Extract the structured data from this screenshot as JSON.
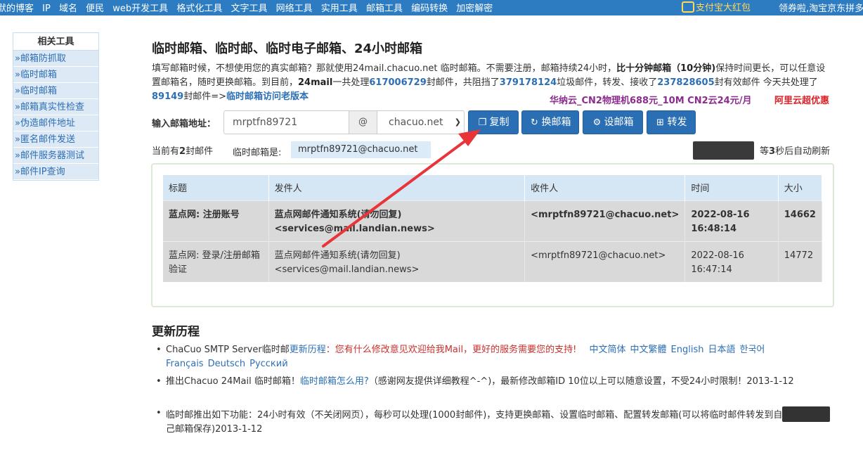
{
  "topnav": {
    "items": [
      "默的博客",
      "IP",
      "域名",
      "便民",
      "web开发工具",
      "格式化工具",
      "文字工具",
      "网络工具",
      "实用工具",
      "邮箱工具",
      "编码转换",
      "加密解密"
    ],
    "alipay": "支付宝大红包",
    "coupon": "领券啦,淘宝京东拼多"
  },
  "sidebar": {
    "head": "相关工具",
    "items": [
      "»邮箱防抓取",
      "»临时邮箱",
      "»临时邮箱",
      "»邮箱真实性检查",
      "»伪造邮件地址",
      "»匿名邮件发送",
      "»邮件服务器测试",
      "»邮件IP查询"
    ]
  },
  "main": {
    "title": "临时邮箱、临时邮、临时电子邮箱、24小时邮箱",
    "intro": {
      "p1": "填写邮箱时候，不想使用您的真实邮箱？那就使用24mail.chacuo.net 临时邮箱。不需要注册，邮箱持续24小时，",
      "p1b": "比十分钟邮箱（10分钟)",
      "p2": "保持时间更长，可以任意设置邮箱名，随时更换邮箱。到目前，",
      "p2b": "24mail",
      "p3": "一共处理",
      "n1": "617006729",
      "p4": "封邮件，共阻挡了",
      "n2": "379178124",
      "p5": "垃圾邮件，转发、接收了",
      "n3": "237828605",
      "p6": "封有效邮件 今天共处理了",
      "n4": "89149",
      "p7": "封邮件=>",
      "old_link": "临时邮箱访问老版本"
    },
    "promo1": "华纳云_CN2物理机688元_10M CN2云24元/月",
    "promo2": "阿里云超优惠",
    "address_label": "输入邮箱地址：",
    "address_value": "mrptfn89721",
    "at": "@",
    "domain": "chacuo.net",
    "buttons": {
      "copy": "复制",
      "change": "换邮箱",
      "set": "设邮箱",
      "forward": "转发"
    },
    "count_prefix": "当前有",
    "count": "2",
    "count_suffix": "封邮件",
    "current_label": "临时邮箱是:",
    "current_value": "mrptfn89721@chacuo.net",
    "refresh_prefix": "等",
    "refresh_seconds": "3",
    "refresh_suffix": "秒后自动刷新"
  },
  "mail_table": {
    "headers": [
      "标题",
      "发件人",
      "收件人",
      "时间",
      "大小"
    ],
    "rows": [
      {
        "subject": "蓝点网: 注册账号",
        "sender_name": "蓝点网邮件通知系统(请勿回复)",
        "sender_addr": "<services@mail.landian.news>",
        "to": "<mrptfn89721@chacuo.net>",
        "time": "2022-08-16 16:48:14",
        "size": "14662"
      },
      {
        "subject": "蓝点网: 登录/注册邮箱验证",
        "sender_name": "蓝点网邮件通知系统(请勿回复)",
        "sender_addr": "<services@mail.landian.news>",
        "to": "<mrptfn89721@chacuo.net>",
        "time": "2022-08-16 16:47:14",
        "size": "14772"
      }
    ]
  },
  "history": {
    "title": "更新历程",
    "i1_a": "ChaCuo SMTP Server临时邮",
    "i1_link": "更新历程",
    "i1_red": "：您有什么修改意见欢迎给我Mail，更好的服务需要您的支持!",
    "langs": [
      "中文简体",
      "中文繁體",
      "English",
      "日本語",
      "한국어",
      "Français",
      "Deutsch",
      "Русский"
    ],
    "i2_a": "推出Chacuo 24Mail 临时邮箱！",
    "i2_link": "临时邮箱怎么用?",
    "i2_b": "（感谢网友提供详细教程^-^)，最新修改邮箱ID 10位以上可以随意设置，不受24小时限制！2013-1-12",
    "i3_a": "临时邮推出如下功能：24小时有效（不关闭网页），每秒可以处理(1000封邮件)，支持更换邮箱、设置临时邮箱、配置转发邮箱(可以将临时邮件转发到自",
    "i3_b": "己邮箱保存)2013-1-12"
  }
}
